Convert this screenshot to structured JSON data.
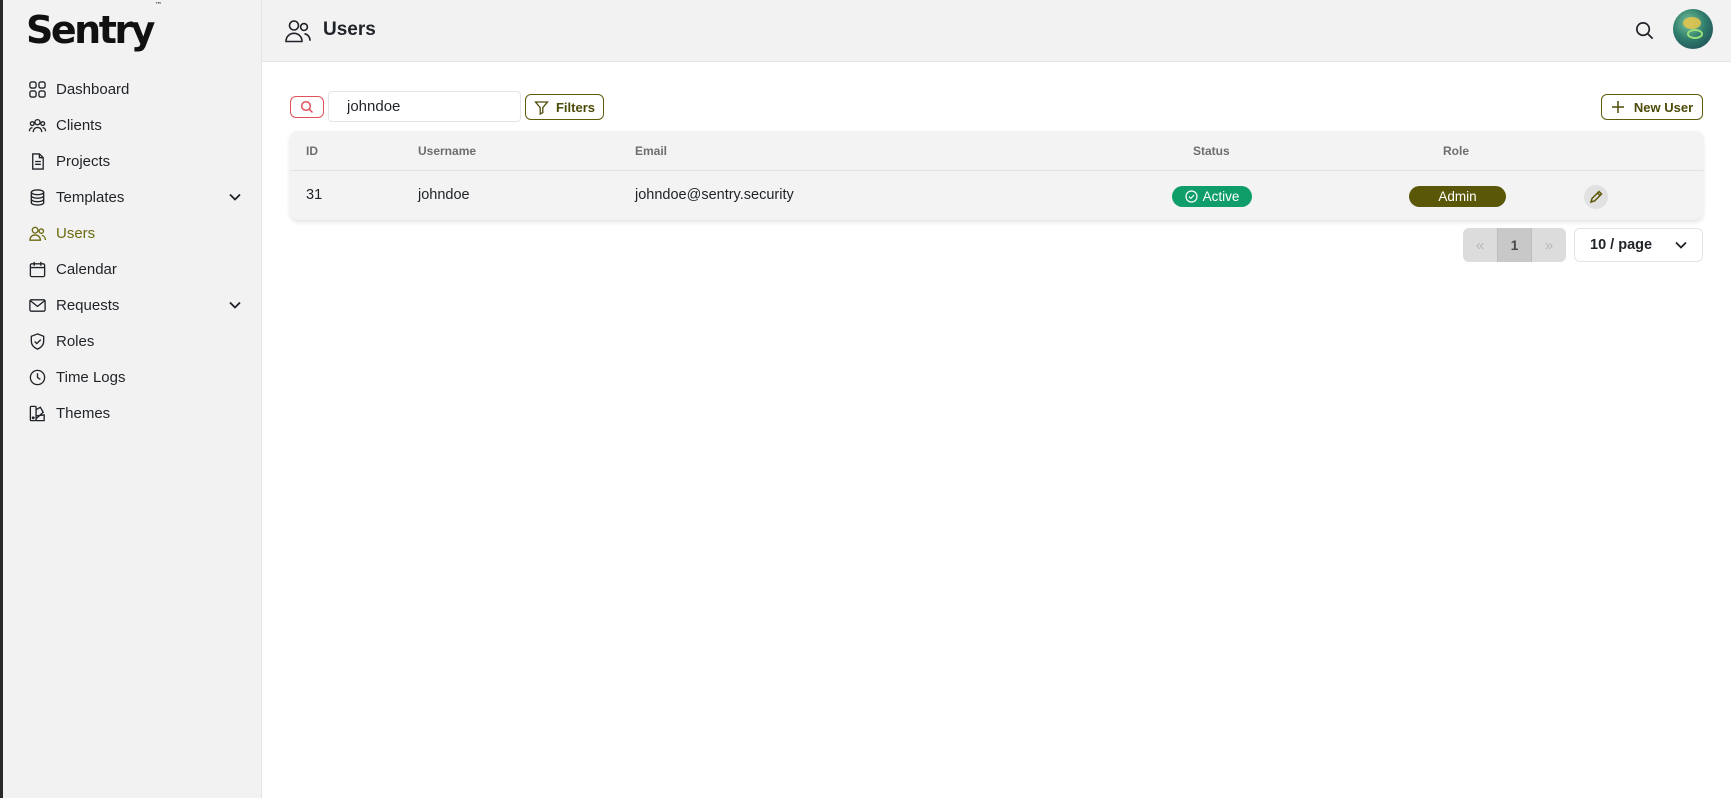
{
  "app": {
    "logo": "Sentry",
    "logo_tm": "™"
  },
  "sidebar": {
    "items": [
      {
        "label": "Dashboard",
        "icon": "dashboard-icon"
      },
      {
        "label": "Clients",
        "icon": "clients-icon"
      },
      {
        "label": "Projects",
        "icon": "document-icon"
      },
      {
        "label": "Templates",
        "icon": "database-icon",
        "expandable": true
      },
      {
        "label": "Users",
        "icon": "users-icon",
        "active": true
      },
      {
        "label": "Calendar",
        "icon": "calendar-icon"
      },
      {
        "label": "Requests",
        "icon": "mail-icon",
        "expandable": true
      },
      {
        "label": "Roles",
        "icon": "shield-check-icon"
      },
      {
        "label": "Time Logs",
        "icon": "clock-icon"
      },
      {
        "label": "Themes",
        "icon": "swatch-icon"
      }
    ]
  },
  "header": {
    "title": "Users"
  },
  "toolbar": {
    "search_value": "johndoe",
    "filters_label": "Filters",
    "new_user_label": "New User"
  },
  "table": {
    "columns": [
      "ID",
      "Username",
      "Email",
      "Status",
      "Role"
    ],
    "rows": [
      {
        "id": "31",
        "username": "johndoe",
        "email": "johndoe@sentry.security",
        "status": "Active",
        "role": "Admin"
      }
    ]
  },
  "pagination": {
    "prev": "«",
    "current": "1",
    "next": "»",
    "page_size": "10 / page"
  },
  "colors": {
    "accent": "#5a5808",
    "active_status": "#0f9d6a",
    "search_border": "#e0525b"
  }
}
